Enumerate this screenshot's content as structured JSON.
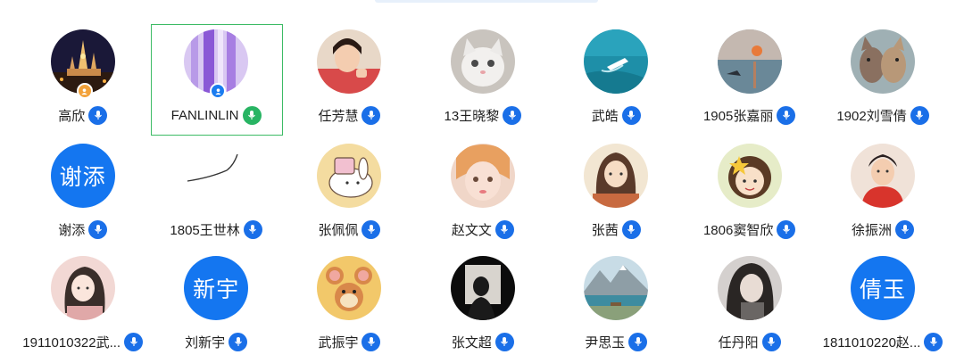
{
  "participants": [
    {
      "name": "高欣",
      "mic": "blue",
      "badge": "orange",
      "avatar": "castle-night-photo"
    },
    {
      "name": "FANLINLIN",
      "mic": "green",
      "badge": "blue",
      "avatar": "purple-abstract-photo",
      "selected": true
    },
    {
      "name": "任芳慧",
      "mic": "blue",
      "avatar": "girl-red-sweater-photo"
    },
    {
      "name": "13王晓黎",
      "mic": "blue",
      "avatar": "white-cat-photo"
    },
    {
      "name": "武皓",
      "mic": "blue",
      "avatar": "ocean-boat-photo"
    },
    {
      "name": "1905张嘉丽",
      "mic": "blue",
      "avatar": "impressionist-painting"
    },
    {
      "name": "1902刘雪倩",
      "mic": "blue",
      "avatar": "two-cats-photo"
    },
    {
      "name": "谢添",
      "mic": "blue",
      "avatar_text": "谢添"
    },
    {
      "name": "1805王世林",
      "mic": "blue",
      "avatar": "line-sketch"
    },
    {
      "name": "张佩佩",
      "mic": "blue",
      "avatar": "cartoon-rabbit"
    },
    {
      "name": "赵文文",
      "mic": "blue",
      "avatar": "doll-face-photo"
    },
    {
      "name": "张茜",
      "mic": "blue",
      "avatar": "anime-girl-illustration"
    },
    {
      "name": "1806窦智欣",
      "mic": "blue",
      "avatar": "cartoon-girl-star"
    },
    {
      "name": "徐振洲",
      "mic": "blue",
      "avatar": "cartoon-man-red"
    },
    {
      "name": "1911010322武...",
      "mic": "blue",
      "avatar": "girl-illustration-pink"
    },
    {
      "name": "刘新宇",
      "mic": "blue",
      "avatar_text": "新宇"
    },
    {
      "name": "武振宇",
      "mic": "blue",
      "avatar": "jerry-mouse-cartoon"
    },
    {
      "name": "张文超",
      "mic": "blue",
      "avatar": "silhouette-window"
    },
    {
      "name": "尹思玉",
      "mic": "blue",
      "avatar": "mountain-lake-photo"
    },
    {
      "name": "任丹阳",
      "mic": "blue",
      "avatar": "girl-bw-photo"
    },
    {
      "name": "1811010220赵...",
      "mic": "blue",
      "avatar_text": "倩玉"
    }
  ],
  "colors": {
    "accent": "#1a6fe8",
    "mic_active": "#28b463",
    "selected_border": "#3dbb65",
    "text_avatar": "#1476f0"
  }
}
